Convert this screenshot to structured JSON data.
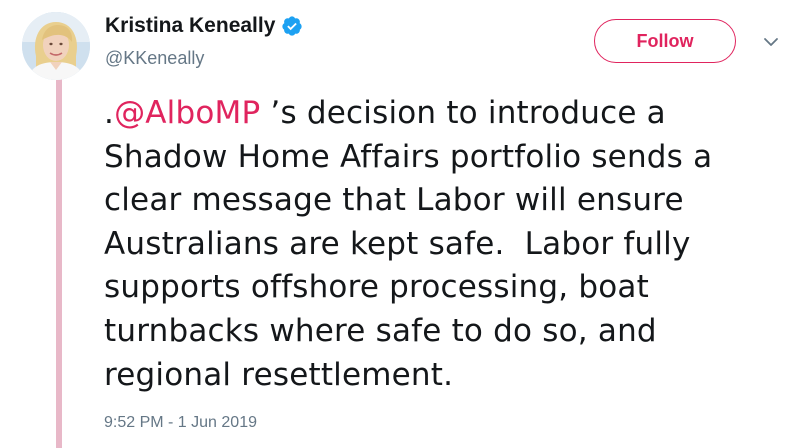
{
  "user": {
    "display_name": "Kristina Keneally",
    "handle": "@KKeneally",
    "verified_icon": "verified-badge-icon"
  },
  "actions": {
    "follow_label": "Follow",
    "more_icon": "chevron-down-icon"
  },
  "tweet": {
    "prefix": ".",
    "mention": "@AlboMP",
    "line1_rest": " ’s decision to introduce a",
    "line2": "Shadow Home Affairs portfolio sends a",
    "line3": "clear message that Labor will ensure",
    "line4": "Australians are kept safe.  Labor fully",
    "line5": "supports offshore processing, boat",
    "line6": "turnbacks where safe to do so, and",
    "line7": "regional resettlement.",
    "timestamp": "9:52 PM - 1 Jun 2019"
  },
  "colors": {
    "accent": "#e0245e",
    "thread_line": "#e8b8c8",
    "verified": "#1da1f2",
    "secondary_text": "#657786"
  }
}
